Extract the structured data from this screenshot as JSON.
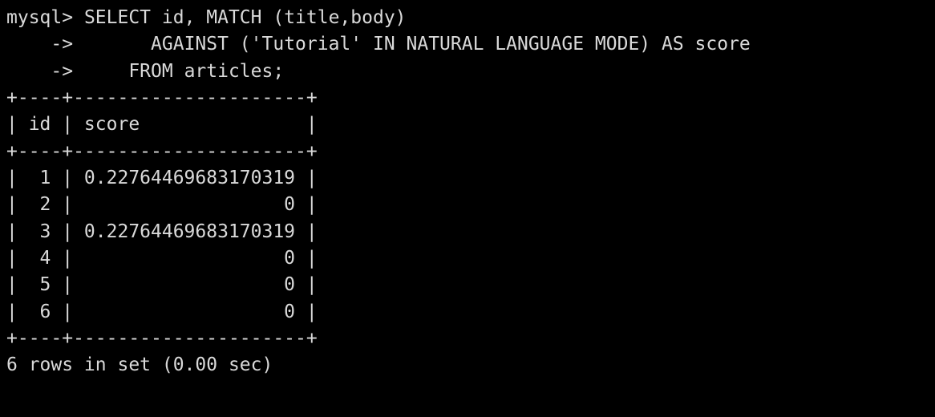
{
  "prompt": "mysql>",
  "continuation": "    ->",
  "query": {
    "line1": " SELECT id, MATCH (title,body)",
    "line2": "       AGAINST ('Tutorial' IN NATURAL LANGUAGE MODE) AS score",
    "line3": "     FROM articles;"
  },
  "table": {
    "border": "+----+---------------------+",
    "header": "| id | score               |",
    "rows": [
      "|  1 | 0.22764469683170319 |",
      "|  2 |                   0 |",
      "|  3 | 0.22764469683170319 |",
      "|  4 |                   0 |",
      "|  5 |                   0 |",
      "|  6 |                   0 |"
    ]
  },
  "summary": "6 rows in set (0.00 sec)"
}
